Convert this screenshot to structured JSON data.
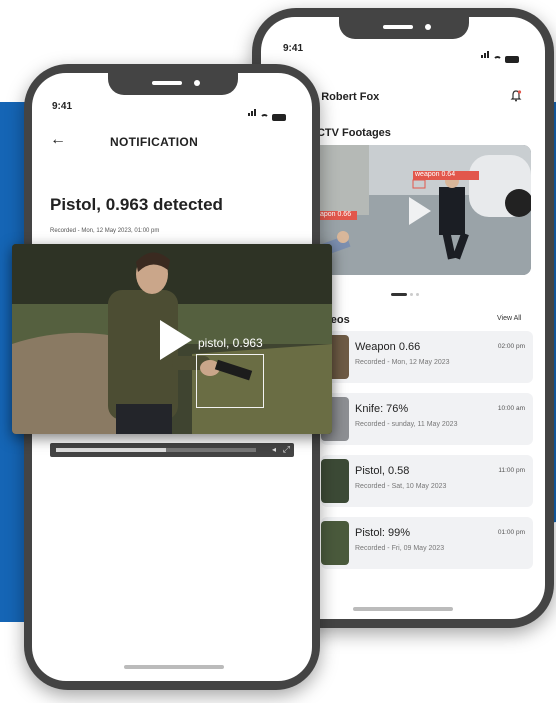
{
  "colors": {
    "brand_blue": "#1565b5",
    "detection_red": "#e2574c"
  },
  "back_phone": {
    "time": "9:41",
    "user_name": "li, Robert Fox",
    "bell_icon": "bell-icon",
    "cctv_title": "CCTV Footages",
    "cctv_labels": {
      "weapon": "weapon 0.64",
      "other": "weapon 0.66"
    },
    "videos_title": "ideos",
    "view_all": "View All",
    "videos": [
      {
        "title": "Weapon 0.66",
        "recorded": "Recorded - Mon, 12 May 2023",
        "time": "02:00 pm"
      },
      {
        "title": "Knife: 76%",
        "recorded": "Recorded - sunday, 11 May 2023",
        "time": "10:00 am"
      },
      {
        "title": "Pistol, 0.58",
        "recorded": "Recorded - Sat, 10 May 2023",
        "time": "11:00 pm"
      },
      {
        "title": "Pistol: 99%",
        "recorded": "Recorded - Fri, 09 May 2023",
        "time": "01:00 pm"
      }
    ]
  },
  "front_phone": {
    "time": "9:41",
    "back_arrow": "←",
    "header_title": "NOTIFICATION",
    "detection_title": "Pistol, 0.963 detected",
    "recorded": "Recorded - Mon, 12 May 2023, 01:00 pm",
    "video_label": "pistol, 0.963",
    "progress": 0.55
  }
}
